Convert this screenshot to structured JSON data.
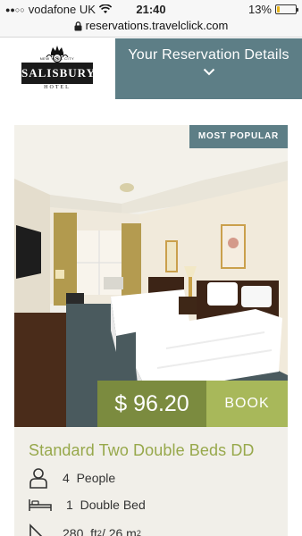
{
  "status_bar": {
    "carrier": "vodafone UK",
    "time": "21:40",
    "battery": "13%",
    "signal_dots": "●●○○"
  },
  "browser": {
    "url": "reservations.travelclick.com"
  },
  "header": {
    "logo": {
      "top_text": "NEW YORK CITY",
      "name": "SALISBURY",
      "sub": "HOTEL"
    },
    "reservation_details_label": "Your Reservation Details"
  },
  "room": {
    "badge": "MOST POPULAR",
    "price": "$ 96.20",
    "book_label": "BOOK",
    "name": "Standard Two Double Beds DD",
    "features": [
      {
        "icon": "person-icon",
        "count": "4",
        "label": "People"
      },
      {
        "icon": "bed-icon",
        "count": "1",
        "label": "Double Bed"
      },
      {
        "icon": "area-icon",
        "count": "280",
        "label": "ft2 / 26 m2"
      }
    ],
    "area_ft": "ft",
    "area_ft_exp": "2",
    "area_sep": " / 26 m",
    "area_m_exp": "2"
  },
  "colors": {
    "teal_header": "#5d7e86",
    "price_bg": "#7b8b3f",
    "book_bg": "#a8b85a",
    "room_name": "#97a84b",
    "battery": "#e8b317"
  }
}
